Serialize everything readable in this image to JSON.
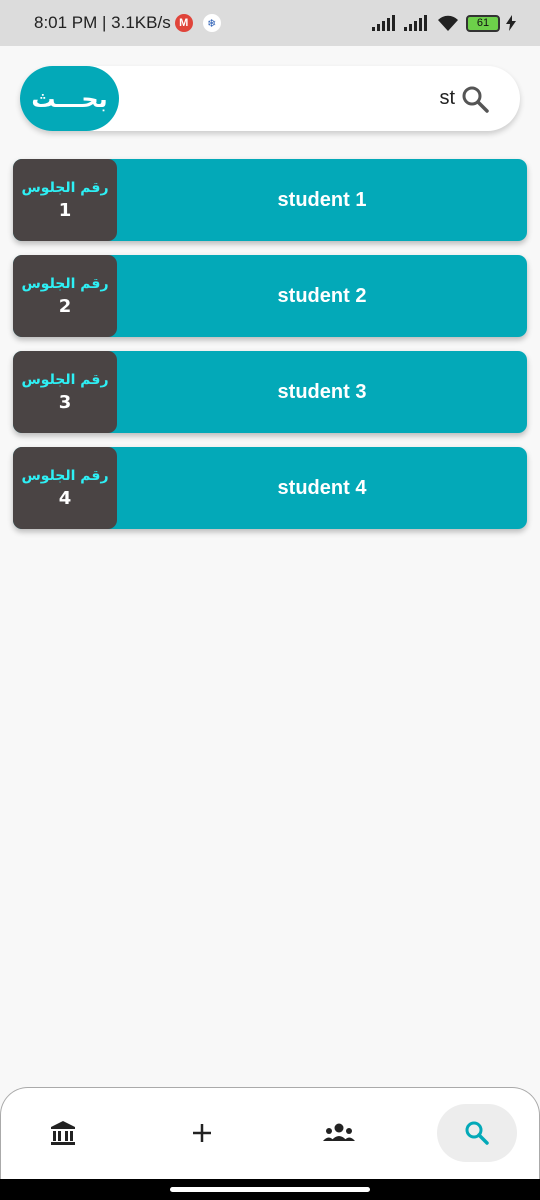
{
  "status_bar": {
    "time_speed": "8:01 PM | 3.1KB/s",
    "notif_m": "M",
    "battery": "61"
  },
  "search": {
    "button_label": "بحـــث",
    "query": "st"
  },
  "seat_label": "رقم الجلوس",
  "students": [
    {
      "seat": "1",
      "name": "student 1"
    },
    {
      "seat": "2",
      "name": "student 2"
    },
    {
      "seat": "3",
      "name": "student 3"
    },
    {
      "seat": "4",
      "name": "student 4"
    }
  ],
  "bottom_nav": {
    "items": [
      {
        "icon": "institution-icon"
      },
      {
        "icon": "plus-icon"
      },
      {
        "icon": "group-icon"
      },
      {
        "icon": "search-icon",
        "active": true
      }
    ]
  },
  "colors": {
    "accent": "#03a9b8",
    "seat_box": "#4a4444",
    "seat_label": "#2ef0f5"
  }
}
